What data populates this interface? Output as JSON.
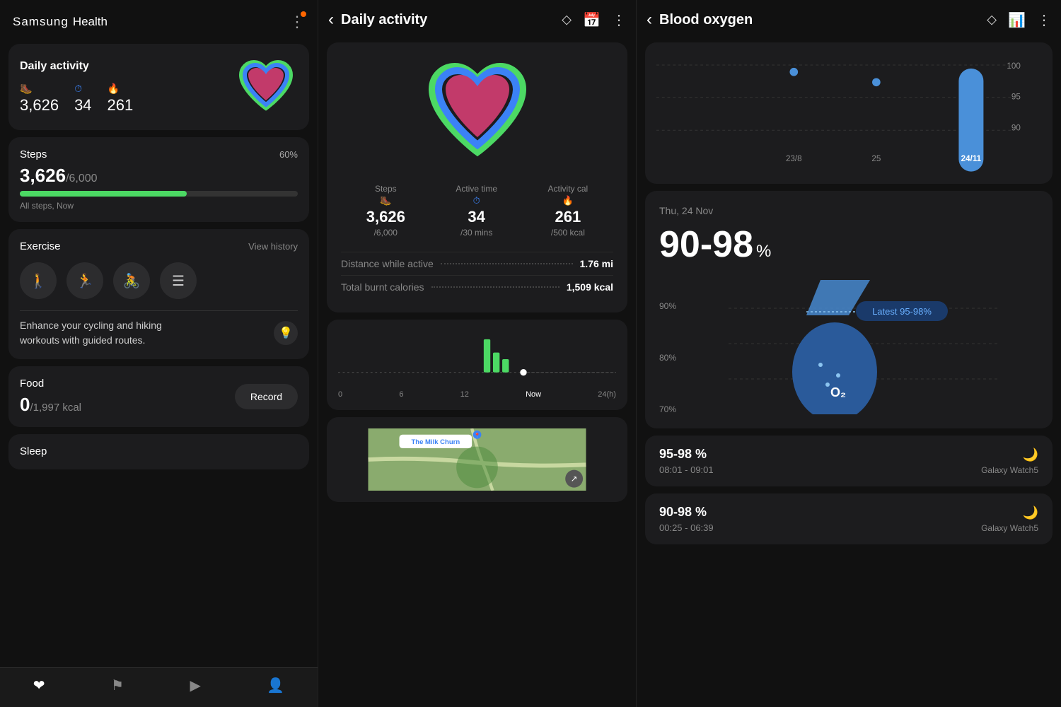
{
  "panel1": {
    "app_name": "Samsung",
    "app_name2": "Health",
    "daily_activity": {
      "title": "Daily activity",
      "steps_value": "3,626",
      "steps_icon": "🥾",
      "active_value": "34",
      "active_icon": "🔵",
      "calories_value": "261",
      "calories_icon": "🔥"
    },
    "steps": {
      "title": "Steps",
      "value": "3,626",
      "goal": "/6,000",
      "percent": "60%",
      "subtitle": "All steps, Now",
      "fill_width": "60"
    },
    "exercise": {
      "title": "Exercise",
      "view_history": "View history",
      "promo_text": "Enhance your cycling and hiking\nworkouts with guided routes."
    },
    "food": {
      "title": "Food",
      "value": "0",
      "goal": "/1,997 kcal",
      "record_btn": "Record"
    },
    "sleep": {
      "title": "Sleep"
    },
    "nav": {
      "home": "🏠",
      "flag": "⛳",
      "play": "▶",
      "person": "👤"
    }
  },
  "panel2": {
    "title": "Daily activity",
    "steps_label": "Steps",
    "steps_value": "3,626",
    "steps_goal": "/6,000",
    "steps_icon": "🥾",
    "active_label": "Active time",
    "active_value": "34",
    "active_goal": "/30 mins",
    "active_icon": "🔵",
    "cal_label": "Activity cal",
    "cal_value": "261",
    "cal_goal": "/500 kcal",
    "cal_icon": "🔥",
    "distance_label": "Distance while active",
    "distance_value": "1.76 mi",
    "calories_label": "Total burnt calories",
    "calories_value": "1,509 kcal",
    "chart_labels": [
      "0",
      "6",
      "12",
      "Now",
      "24(h)"
    ]
  },
  "panel3": {
    "title": "Blood oxygen",
    "graph_labels": {
      "y100": "100",
      "y95": "95",
      "y90": "90",
      "x1": "23/8",
      "x2": "25",
      "x3": "24/11"
    },
    "date": "Thu, 24 Nov",
    "range": "90-98",
    "percent_label": "%",
    "latest_label": "Latest 95-98%",
    "y_labels": [
      "90%",
      "80%",
      "70%"
    ],
    "o2_symbol": "O₂",
    "readings": [
      {
        "range": "95-98 %",
        "time": "08:01 - 09:01",
        "device": "Galaxy Watch5"
      },
      {
        "range": "90-98 %",
        "time": "00:25 - 06:39",
        "device": "Galaxy Watch5"
      }
    ]
  },
  "colors": {
    "green": "#4cd964",
    "blue": "#3b82f6",
    "pink": "#e8457a",
    "accent": "#0a84ff",
    "card_bg": "#1c1c1e",
    "bar_bg": "#333"
  }
}
